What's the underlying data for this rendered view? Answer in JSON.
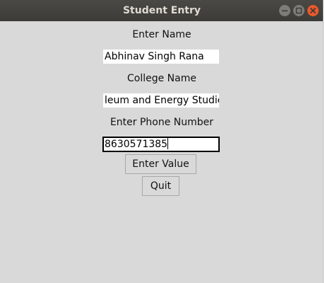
{
  "window": {
    "title": "Student Entry"
  },
  "form": {
    "name_label": "Enter Name",
    "name_value": "Abhinav Singh Rana",
    "college_label": "College Name",
    "college_value": "leum and Energy Studies",
    "phone_label": "Enter Phone Number",
    "phone_value": "8630571385"
  },
  "buttons": {
    "enter_label": "Enter Value",
    "quit_label": "Quit"
  },
  "colors": {
    "background": "#d9d9d9",
    "titlebar": "#3c3b37",
    "close_button": "#e9592a"
  }
}
